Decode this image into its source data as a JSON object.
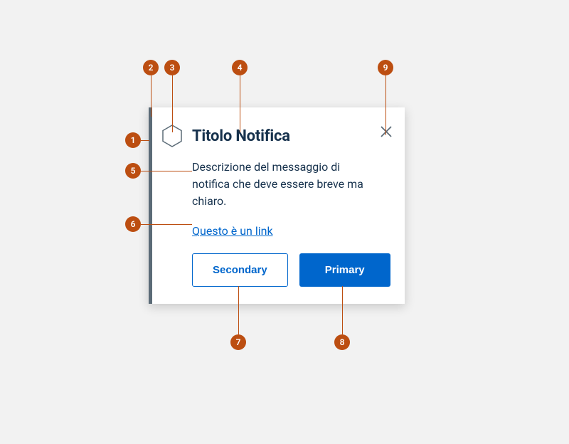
{
  "notification": {
    "title": "Titolo Notifica",
    "description": "Descrizione del messaggio di notifica che deve essere breve ma chiaro.",
    "link_text": "Questo è un link",
    "secondary_label": "Secondary",
    "primary_label": "Primary"
  },
  "annotations": {
    "a1": "1",
    "a2": "2",
    "a3": "3",
    "a4": "4",
    "a5": "5",
    "a6": "6",
    "a7": "7",
    "a8": "8",
    "a9": "9"
  }
}
